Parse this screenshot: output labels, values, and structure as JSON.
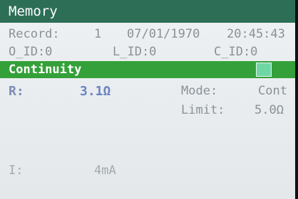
{
  "header": {
    "title": "Memory"
  },
  "record": {
    "label": "Record:",
    "number": "1",
    "date": "07/01/1970",
    "time": "20:45:43"
  },
  "ids": {
    "o_id": "O_ID:0",
    "l_id": "L_ID:0",
    "c_id": "C_ID:0"
  },
  "section": {
    "title": "Continuity",
    "indicator_color": "#6fd7a4"
  },
  "measurement": {
    "r_label": "R:",
    "r_value": "3.1Ω",
    "mode_label": "Mode:",
    "mode_value": "Cont",
    "limit_label": "Limit:",
    "limit_value": "5.0Ω",
    "i_label": "I:",
    "i_value": "4mA"
  },
  "colors": {
    "titlebar": "#2d6e57",
    "section_bar": "#34a039",
    "r_value": "#6a83c0"
  }
}
